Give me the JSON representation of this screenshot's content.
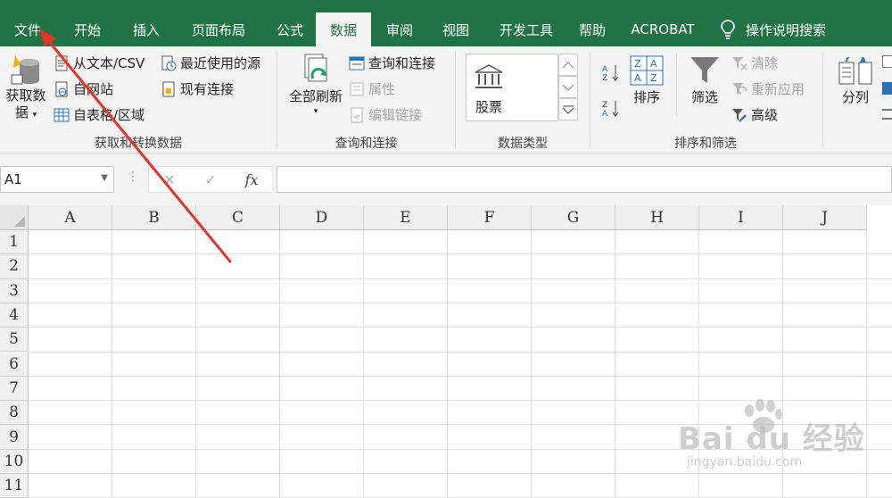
{
  "tabs": {
    "file": "文件",
    "home": "开始",
    "insert": "插入",
    "page_layout": "页面布局",
    "formulas": "公式",
    "data": "数据",
    "review": "审阅",
    "view": "视图",
    "developer": "开发工具",
    "help": "帮助",
    "acrobat": "ACROBAT",
    "tell_me": "操作说明搜索"
  },
  "ribbon": {
    "get_data": {
      "big_button_line1": "获取数",
      "big_button_line2": "据",
      "from_text_csv": "从文本/CSV",
      "from_web": "自网站",
      "from_table": "自表格/区域",
      "recent_sources": "最近使用的源",
      "existing_connections": "现有连接",
      "label": "获取和转换数据"
    },
    "queries": {
      "refresh_all": "全部刷新",
      "queries_connections": "查询和连接",
      "properties": "属性",
      "edit_links": "编辑链接",
      "label": "查询和连接"
    },
    "data_types": {
      "stocks": "股票",
      "label": "数据类型"
    },
    "sort_filter": {
      "sort": "排序",
      "filter": "筛选",
      "clear": "清除",
      "reapply": "重新应用",
      "advanced": "高级",
      "label": "排序和筛选"
    },
    "data_tools": {
      "text_to_columns": "分列"
    }
  },
  "formula_bar": {
    "name_box": "A1",
    "formula": ""
  },
  "columns": [
    "A",
    "B",
    "C",
    "D",
    "E",
    "F",
    "G",
    "H",
    "I",
    "J"
  ],
  "rows": [
    "1",
    "2",
    "3",
    "4",
    "5",
    "6",
    "7",
    "8",
    "9",
    "10",
    "11"
  ],
  "watermark": {
    "main": "Bai du 经验",
    "sub": "jingyan.baidu.com"
  },
  "colors": {
    "excel_green": "#217346",
    "annotation_arrow": "#e8322a"
  }
}
